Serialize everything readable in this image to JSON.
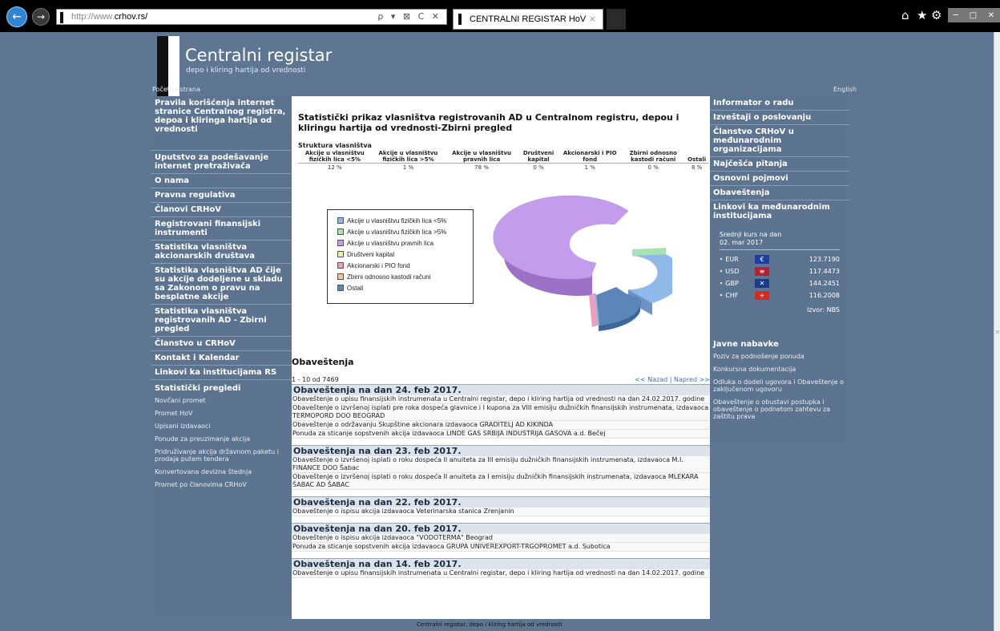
{
  "browser": {
    "url_prefix": "http://www.",
    "url_domain": "crhov.rs/",
    "url_tools": "ρ ▾ ⊠ C ✕",
    "tab_title": "CENTRALNI REGISTAR HoV",
    "tab_close": "×"
  },
  "header": {
    "title": "Centralni registar",
    "subtitle": "depo i kliring hartija od vrednosti",
    "home_link": "Početna strana",
    "lang_link": "English"
  },
  "left_nav": {
    "items": [
      "Pravila korišćenja internet stranice Centralnog registra, depoa i kliringa hartija od vrednosti",
      "Uputstvo za podešavanje internet pretraživača",
      "O nama",
      "Pravna regulativa",
      "Članovi CRHoV",
      "Registrovani finansijski instrumenti",
      "Statistika vlasništva akcionarskih društava",
      "Statistika vlasništva AD čije su akcije dodeljene u skladu sa Zakonom o pravu na besplatne akcije",
      "Statistika vlasništva registrovanih AD - Zbirni pregled",
      "Članstvo u CRHoV",
      "Kontakt i Kalendar",
      "Linkovi ka institucijama RS",
      "Statistički pregledi"
    ],
    "sub_items": [
      "Novčani promet",
      "Promet HoV",
      "Upisani izdavaoci",
      "Ponude za preuzimanje akcija",
      "Pridruživanje akcija državnom paketu i prodaja putem tendera",
      "Konvertovana devizna štednja",
      "Promet po članovima CRHoV"
    ]
  },
  "main": {
    "title": "Statistički prikaz vlasništva registrovanih AD u Centralnom registru, depou i kliringu hartija od vrednosti-Zbirni pregled",
    "structure_label": "Struktura vlasništva",
    "columns": [
      "Akcije u vlasništvu fizičkih lica <5%",
      "Akcije u vlasništvu fizičkih lica >5%",
      "Akcije u vlasništvu pravnih lica",
      "Društveni kapital",
      "Akcionarski i PIO fond",
      "Zbirni odnosno kastodi računi",
      "Ostali"
    ],
    "values": [
      "12 %",
      "1 %",
      "78 %",
      "0 %",
      "1 %",
      "0 %",
      "8 %"
    ],
    "legend": [
      "Akcije u vlasništvu fizičkih lica <5%",
      "Akcije u vlasništvu fizičkih lica >5%",
      "Akcije u vlasništvu pravnih lica",
      "Društveni kapital",
      "Akcionarski i PIO fond",
      "Zbirni odnosno kastodi računi",
      "Ostali"
    ],
    "legend_colors": [
      "#8fb9e8",
      "#a7e3b2",
      "#c49cec",
      "#eaf2b0",
      "#ef9ec2",
      "#f2c59a",
      "#5c85b8"
    ],
    "news_heading": "Obaveštenja",
    "news_count": "1 - 10 od 7469",
    "pager_prev": "<< Nazad",
    "pager_sep": " | ",
    "pager_next": "Napred >>",
    "news_days": [
      {
        "title": "Obaveštenja na dan 24. feb 2017.",
        "items": [
          "Obaveštenje o upisu finansijskih instrumenata u Centralni registar, depo i kliring hartija od vrednosti na dan 24.02.2017. godine",
          "Obaveštenje o izvršenoj isplati pre roka dospeća glavnice i I kupona za VIII emisiju dužničkih finansijskih instrumenata, izdavaoca TERMOPORD DOO BEOGRAD",
          "Obaveštenje o održavanju Skupštine akcionara izdavaoca GRADITELJ AD KIKINDA",
          "Ponuda za sticanje sopstvenih akcija izdavaoca LINDE GAS SRBIJA INDUSTRIJA GASOVA a.d. Bečej"
        ]
      },
      {
        "title": "Obaveštenja na dan 23. feb 2017.",
        "items": [
          "Obaveštenje o izvršenoj isplati o roku dospeća II anuiteta za III emisiju dužničkih finansijskih instrumenata, izdavaoca M.I. FINANCE DOO Šabac",
          "Obaveštenje o izvršenoj isplati o roku dospeća II anuiteta za I emisiju dužničkih finansijskih instrumenata, izdavaoca MLEKARA ŠABAC AD ŠABAC"
        ]
      },
      {
        "title": "Obaveštenja na dan 22. feb 2017.",
        "items": [
          "Obaveštenje o ispisu akcija izdavaoca Veterinarska stanica Zrenjanin"
        ]
      },
      {
        "title": "Obaveštenja na dan 20. feb 2017.",
        "items": [
          "Obaveštenje o ispisu akcija izdavaoca \"VODOTERMA\" Beograd",
          "Ponuda za sticanje sopstvenih akcija izdavaoca GRUPA UNIVEREXPORT-TRGOPROMET a.d. Subotica"
        ]
      },
      {
        "title": "Obaveštenja na dan 14. feb 2017.",
        "items": [
          "Obaveštenje o upisu finansijskih instrumenata u Centralni registar, depo i kliring hartija od vrednosti na dan 14.02.2017. godine"
        ]
      }
    ],
    "footer": "Centralni registar, depo i kliring hartija od vrednosti"
  },
  "right_nav": {
    "items": [
      "Informator o radu",
      "Izveštaji o poslovanju",
      "Članstvo CRHoV u međunarodnim organizacijama",
      "Najčešća pitanja",
      "Osnovni pojmovi",
      "Obaveštenja",
      "Linkovi ka međunarodnim institucijama"
    ],
    "rates_title_1": "Srednji kurs na dan",
    "rates_title_2": "02. mar 2017",
    "rates": [
      {
        "cur": "EUR",
        "value": "123.7190",
        "flag": "eur-flag-icon",
        "color": "#1d3f9a",
        "glyph": "€"
      },
      {
        "cur": "USD",
        "value": "117.4473",
        "flag": "usa-flag-icon",
        "color": "#b22234",
        "glyph": "≡"
      },
      {
        "cur": "GBP",
        "value": "144.2451",
        "flag": "uk-flag-icon",
        "color": "#1e3b8a",
        "glyph": "✕"
      },
      {
        "cur": "CHF",
        "value": "116.2008",
        "flag": "swiss-flag-icon",
        "color": "#d52b1e",
        "glyph": "+"
      }
    ],
    "rates_source": "Izvor: NBS",
    "javne_title": "Javne nabavke",
    "javne_links": [
      "Poziv za podnošenje ponuda",
      "Konkursna dokumentacija",
      "Odluka o dodeli ugovora i Obaveštenje o zaključenom ugovoru",
      "Obaveštenje o obustavi postupka i obaveštenje o podnetom zahtevu za zaštitu prava"
    ]
  }
}
